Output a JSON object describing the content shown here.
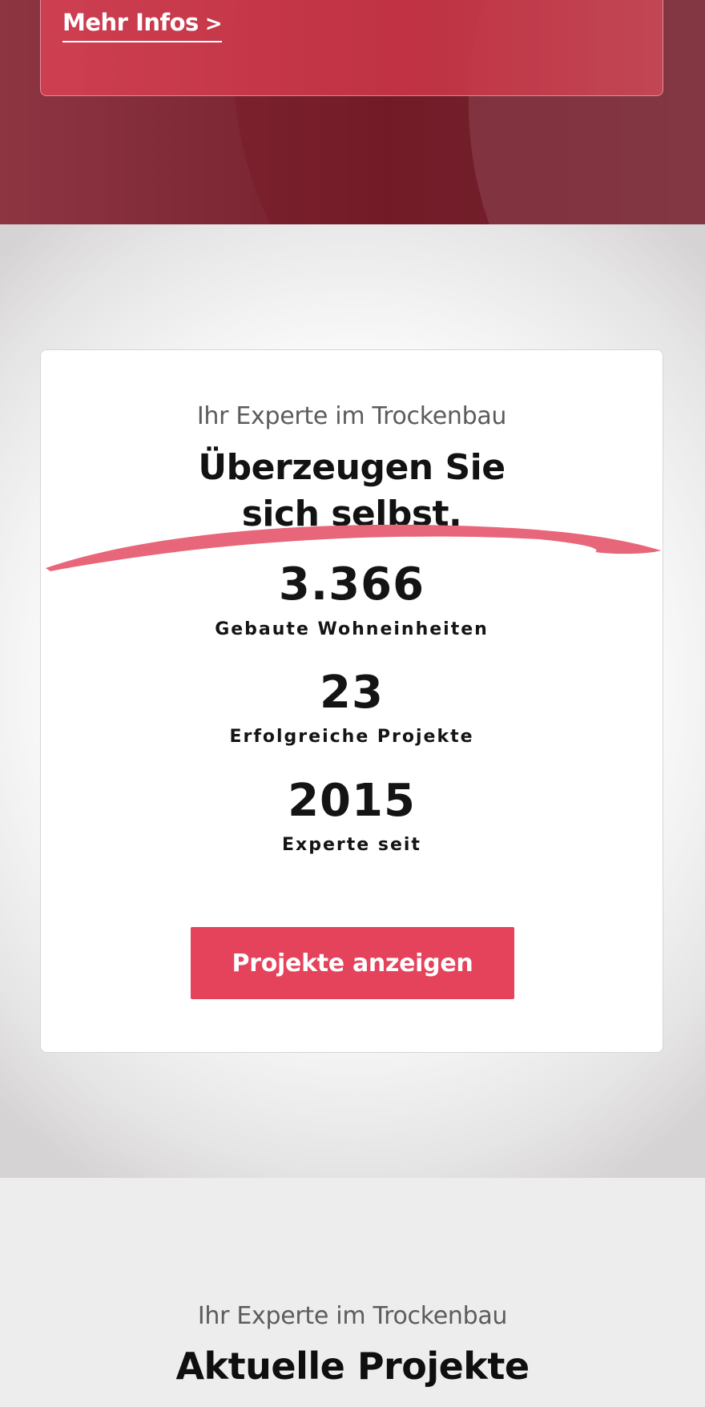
{
  "hero": {
    "link_label": "Mehr Infos",
    "link_chevron": ">"
  },
  "stats": {
    "subtitle": "Ihr Experte im Trockenbau",
    "title_line1": "Überzeugen Sie",
    "title_line2": "sich selbst.",
    "items": [
      {
        "value": "3.366",
        "label": "Gebaute Wohneinheiten"
      },
      {
        "value": "23",
        "label": "Erfolgreiche Projekte"
      },
      {
        "value": "2015",
        "label": "Experte seit"
      }
    ],
    "button_label": "Projekte anzeigen"
  },
  "projects": {
    "subtitle": "Ihr Experte im Trockenbau",
    "title": "Aktuelle Projekte"
  },
  "colors": {
    "accent": "#e4435b",
    "swoosh": "#e8667a",
    "hero_dark": "#6c1c27",
    "text": "#141414"
  }
}
